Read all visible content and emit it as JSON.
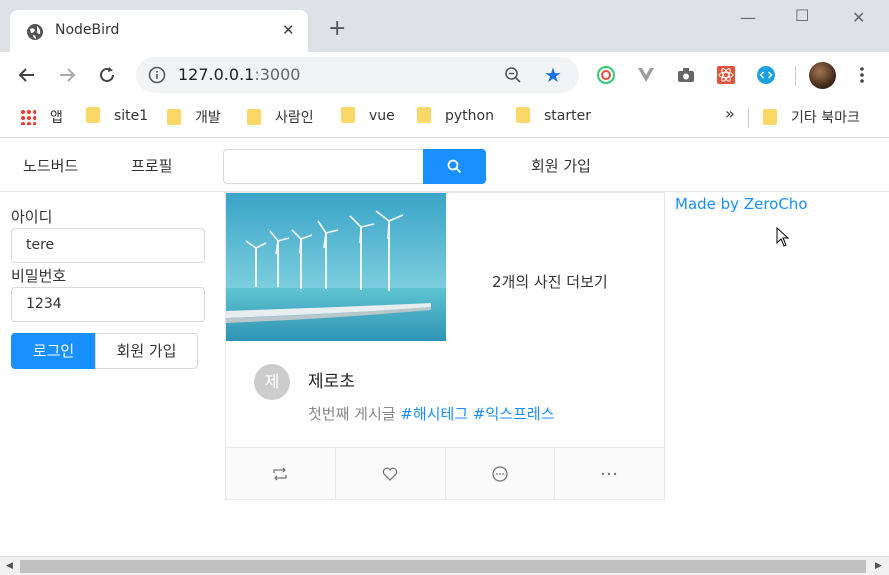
{
  "browser": {
    "tab_title": "NodeBird",
    "url_host": "127.0.0.1",
    "url_port": ":3000",
    "bookmarks": [
      "앱",
      "site1",
      "개발",
      "사람인",
      "vue",
      "python",
      "starter"
    ],
    "bookmarks_overflow": "»",
    "other_bookmarks": "기타 북마크"
  },
  "menu": {
    "home": "노드버드",
    "profile": "프로필",
    "search_value": "",
    "signup": "회원 가입"
  },
  "login": {
    "id_label": "아이디",
    "id_value": "tere",
    "pw_label": "비밀번호",
    "pw_value": "1234",
    "login_button": "로그인",
    "signup_button": "회원 가입"
  },
  "post": {
    "more_photos": "2개의 사진 더보기",
    "avatar_initial": "제",
    "author": "제로초",
    "content_text": "첫번째 게시글",
    "hashtags": [
      "#해시테그",
      "#익스프레스"
    ]
  },
  "footer": {
    "made_by": "Made by ZeroCho"
  },
  "colors": {
    "primary": "#1890ff",
    "chrome_tabbar": "#dee1e6"
  }
}
